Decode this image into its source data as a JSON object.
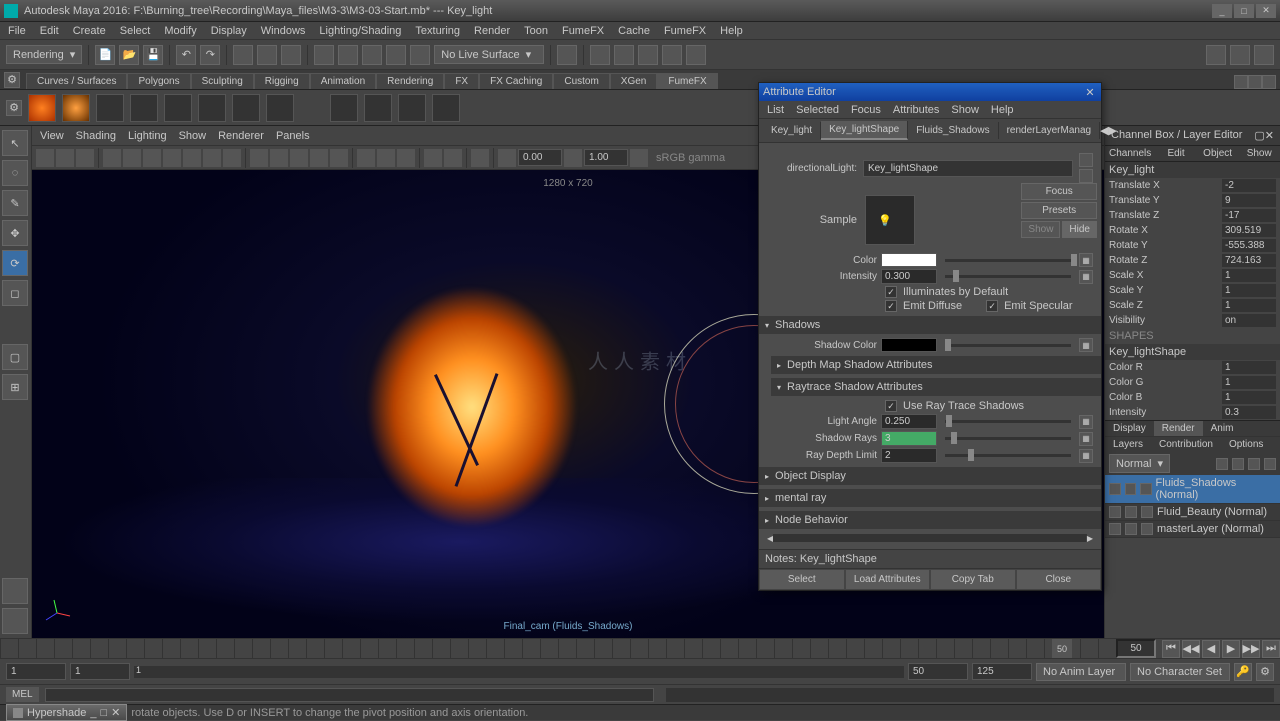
{
  "title": "Autodesk Maya 2016: F:\\Burning_tree\\Recording\\Maya_files\\M3-3\\M3-03-Start.mb*  ---  Key_light",
  "menubar": [
    "File",
    "Edit",
    "Create",
    "Select",
    "Modify",
    "Display",
    "Windows",
    "Lighting/Shading",
    "Texturing",
    "Render",
    "Toon",
    "FumeFX",
    "Cache",
    "FumeFX",
    "Help"
  ],
  "workspace_dropdown": "Rendering",
  "live_surface": "No Live Surface",
  "shelf_tabs": [
    "Curves / Surfaces",
    "Polygons",
    "Sculpting",
    "Rigging",
    "Animation",
    "Rendering",
    "FX",
    "FX Caching",
    "Custom",
    "XGen",
    "FumeFX"
  ],
  "shelf_active": "FumeFX",
  "viewport_menus": [
    "View",
    "Shading",
    "Lighting",
    "Show",
    "Renderer",
    "Panels"
  ],
  "vp_field1": "0.00",
  "vp_field2": "1.00",
  "vp_gamma": "sRGB gamma",
  "vp_res": "1280 x 720",
  "vp_cam": "Final_cam (Fluids_Shadows)",
  "channel_box": {
    "title": "Channel Box / Layer Editor",
    "tabs": [
      "Channels",
      "Edit",
      "Object",
      "Show"
    ],
    "node": "Key_light",
    "attributes": [
      {
        "label": "Translate X",
        "value": "-2"
      },
      {
        "label": "Translate Y",
        "value": "9"
      },
      {
        "label": "Translate Z",
        "value": "-17"
      },
      {
        "label": "Rotate X",
        "value": "309.519"
      },
      {
        "label": "Rotate Y",
        "value": "-555.388"
      },
      {
        "label": "Rotate Z",
        "value": "724.163"
      },
      {
        "label": "Scale X",
        "value": "1"
      },
      {
        "label": "Scale Y",
        "value": "1"
      },
      {
        "label": "Scale Z",
        "value": "1"
      },
      {
        "label": "Visibility",
        "value": "on"
      }
    ],
    "shapes_header": "SHAPES",
    "shape_node": "Key_lightShape",
    "shape_attributes": [
      {
        "label": "Color R",
        "value": "1"
      },
      {
        "label": "Color G",
        "value": "1"
      },
      {
        "label": "Color B",
        "value": "1"
      },
      {
        "label": "Intensity",
        "value": "0.3"
      }
    ],
    "layer_tabs_top": [
      "Display",
      "Render",
      "Anim"
    ],
    "layer_tabs_active": "Render",
    "layer_tabs2": [
      "Layers",
      "Contribution",
      "Options"
    ],
    "layer_mode": "Normal",
    "layers": [
      {
        "name": "Fluids_Shadows (Normal)",
        "selected": true
      },
      {
        "name": "Fluid_Beauty (Normal)",
        "selected": false
      },
      {
        "name": "masterLayer (Normal)",
        "selected": false
      }
    ]
  },
  "attribute_editor": {
    "title": "Attribute Editor",
    "menus": [
      "List",
      "Selected",
      "Focus",
      "Attributes",
      "Show",
      "Help"
    ],
    "tabs": [
      "Key_light",
      "Key_lightShape",
      "Fluids_Shadows",
      "renderLayerManag"
    ],
    "active_tab": "Key_lightShape",
    "right_btns": [
      "Focus",
      "Presets"
    ],
    "show_label": "Show",
    "hide_label": "Hide",
    "node_type": "directionalLight:",
    "node_name": "Key_lightShape",
    "sample_label": "Sample",
    "color_label": "Color",
    "intensity_label": "Intensity",
    "intensity_value": "0.300",
    "illum_default": "Illuminates by Default",
    "emit_diffuse": "Emit Diffuse",
    "emit_specular": "Emit Specular",
    "shadows_header": "Shadows",
    "shadow_color_label": "Shadow Color",
    "depth_map_header": "Depth Map Shadow Attributes",
    "raytrace_header": "Raytrace Shadow Attributes",
    "use_rt": "Use Ray Trace Shadows",
    "light_angle_label": "Light Angle",
    "light_angle_value": "0.250",
    "shadow_rays_label": "Shadow Rays",
    "shadow_rays_value": "3",
    "ray_depth_label": "Ray Depth Limit",
    "ray_depth_value": "2",
    "obj_display": "Object Display",
    "mental_ray": "mental ray",
    "node_behavior": "Node Behavior",
    "notes_label": "Notes:  Key_lightShape",
    "footer": [
      "Select",
      "Load Attributes",
      "Copy Tab",
      "Close"
    ]
  },
  "timeline": {
    "current": "50",
    "end": "50",
    "range_start": "1",
    "range_start2": "1",
    "range_end": "50",
    "range_end2": "125",
    "anim_layer": "No Anim Layer",
    "char_set": "No Character Set"
  },
  "cmdline_label": "MEL",
  "statusbar_hint": "rotate objects. Use D or INSERT to change the pivot position and axis orientation.",
  "taskbar_item": "Hypershade",
  "watermark": "人人素材"
}
